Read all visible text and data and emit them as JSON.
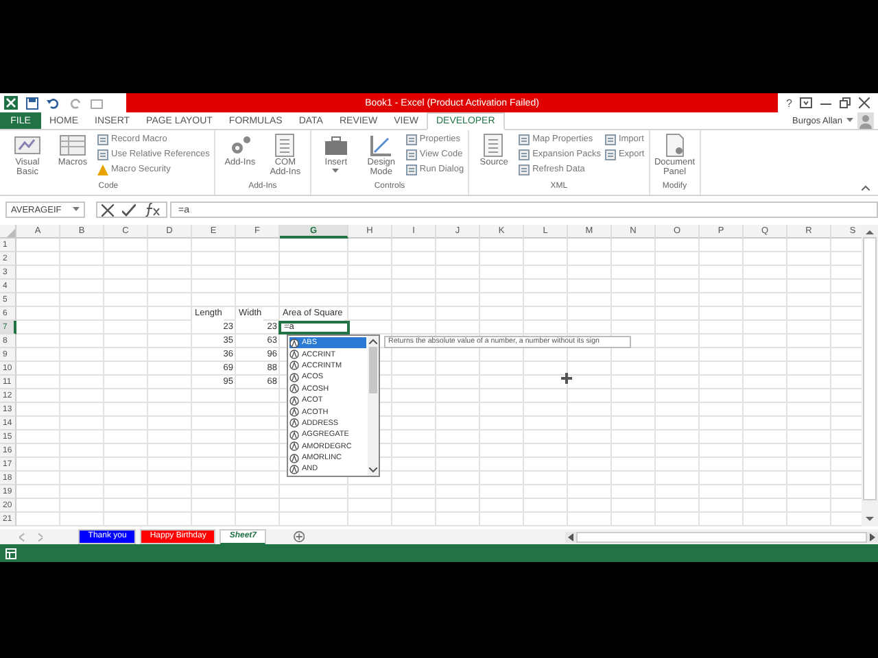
{
  "title_bar": {
    "title": "Book1 - Excel (Product Activation Failed)",
    "help": "?"
  },
  "ribbon_tabs": [
    {
      "label": "FILE",
      "kind": "file",
      "selected": false
    },
    {
      "label": "HOME",
      "kind": "tab",
      "selected": false
    },
    {
      "label": "INSERT",
      "kind": "tab",
      "selected": false
    },
    {
      "label": "PAGE LAYOUT",
      "kind": "tab",
      "selected": false
    },
    {
      "label": "FORMULAS",
      "kind": "tab",
      "selected": false
    },
    {
      "label": "DATA",
      "kind": "tab",
      "selected": false
    },
    {
      "label": "REVIEW",
      "kind": "tab",
      "selected": false
    },
    {
      "label": "VIEW",
      "kind": "tab",
      "selected": false
    },
    {
      "label": "DEVELOPER",
      "kind": "tab",
      "selected": true
    }
  ],
  "user": {
    "name": "Burgos Allan"
  },
  "ribbon_groups": [
    {
      "label": "Code",
      "large": [
        {
          "label": "Visual Basic"
        },
        {
          "label": "Macros"
        }
      ],
      "small_columns": [
        [
          {
            "label": "Record Macro"
          },
          {
            "label": "Use Relative References"
          },
          {
            "label": "Macro Security"
          }
        ]
      ]
    },
    {
      "label": "Add-Ins",
      "large": [
        {
          "label": "Add-Ins"
        },
        {
          "label": "COM Add-Ins"
        }
      ]
    },
    {
      "label": "Controls",
      "large": [
        {
          "label": "Insert",
          "has_menu": true
        },
        {
          "label": "Design Mode"
        }
      ],
      "small_columns": [
        [
          {
            "label": "Properties"
          },
          {
            "label": "View Code"
          },
          {
            "label": "Run Dialog"
          }
        ]
      ]
    },
    {
      "label": "XML",
      "large": [
        {
          "label": "Source"
        }
      ],
      "small_columns": [
        [
          {
            "label": "Map Properties"
          },
          {
            "label": "Expansion Packs"
          },
          {
            "label": "Refresh Data"
          }
        ],
        [
          {
            "label": "Import"
          },
          {
            "label": "Export"
          }
        ]
      ]
    },
    {
      "label": "Modify",
      "large": [
        {
          "label": "Document Panel"
        }
      ]
    }
  ],
  "formula_bar": {
    "name_box": "AVERAGEIF",
    "formula": "=a"
  },
  "columns": [
    {
      "label": "A",
      "selected": false
    },
    {
      "label": "B",
      "selected": false
    },
    {
      "label": "C",
      "selected": false
    },
    {
      "label": "D",
      "selected": false
    },
    {
      "label": "E",
      "selected": false
    },
    {
      "label": "F",
      "selected": false
    },
    {
      "label": "G",
      "selected": true
    },
    {
      "label": "H",
      "selected": false
    },
    {
      "label": "I",
      "selected": false
    },
    {
      "label": "J",
      "selected": false
    },
    {
      "label": "K",
      "selected": false
    },
    {
      "label": "L",
      "selected": false
    },
    {
      "label": "M",
      "selected": false
    },
    {
      "label": "N",
      "selected": false
    },
    {
      "label": "O",
      "selected": false
    },
    {
      "label": "P",
      "selected": false
    },
    {
      "label": "Q",
      "selected": false
    },
    {
      "label": "R",
      "selected": false
    },
    {
      "label": "S",
      "selected": false
    }
  ],
  "rows": [
    {
      "label": "1",
      "selected": false
    },
    {
      "label": "2",
      "selected": false
    },
    {
      "label": "3",
      "selected": false
    },
    {
      "label": "4",
      "selected": false
    },
    {
      "label": "5",
      "selected": false
    },
    {
      "label": "6",
      "selected": false
    },
    {
      "label": "7",
      "selected": true
    },
    {
      "label": "8",
      "selected": false
    },
    {
      "label": "9",
      "selected": false
    },
    {
      "label": "10",
      "selected": false
    },
    {
      "label": "11",
      "selected": false
    },
    {
      "label": "12",
      "selected": false
    },
    {
      "label": "13",
      "selected": false
    },
    {
      "label": "14",
      "selected": false
    },
    {
      "label": "15",
      "selected": false
    },
    {
      "label": "16",
      "selected": false
    },
    {
      "label": "17",
      "selected": false
    },
    {
      "label": "18",
      "selected": false
    },
    {
      "label": "19",
      "selected": false
    },
    {
      "label": "20",
      "selected": false
    },
    {
      "label": "21",
      "selected": false
    }
  ],
  "table": {
    "header": [
      "Length",
      "Width",
      "Area of Square"
    ],
    "rows": [
      [
        {
          "value": "23",
          "kind": "number"
        },
        {
          "value": "23",
          "kind": "number"
        },
        {
          "value": "=a",
          "kind": "editing"
        }
      ],
      [
        {
          "value": "35",
          "kind": "number"
        },
        {
          "value": "63",
          "kind": "number"
        }
      ],
      [
        {
          "value": "36",
          "kind": "number"
        },
        {
          "value": "96",
          "kind": "number"
        }
      ],
      [
        {
          "value": "69",
          "kind": "number"
        },
        {
          "value": "88",
          "kind": "number"
        }
      ],
      [
        {
          "value": "95",
          "kind": "number"
        },
        {
          "value": "68",
          "kind": "number"
        }
      ]
    ]
  },
  "autocomplete": {
    "items": [
      {
        "label": "ABS",
        "selected": true
      },
      {
        "label": "ACCRINT",
        "selected": false
      },
      {
        "label": "ACCRINTM",
        "selected": false
      },
      {
        "label": "ACOS",
        "selected": false
      },
      {
        "label": "ACOSH",
        "selected": false
      },
      {
        "label": "ACOT",
        "selected": false
      },
      {
        "label": "ACOTH",
        "selected": false
      },
      {
        "label": "ADDRESS",
        "selected": false
      },
      {
        "label": "AGGREGATE",
        "selected": false
      },
      {
        "label": "AMORDEGRC",
        "selected": false
      },
      {
        "label": "AMORLINC",
        "selected": false
      },
      {
        "label": "AND",
        "selected": false
      }
    ],
    "tooltip": "Returns the absolute value of a number, a number without its sign"
  },
  "sheet_tabs": [
    {
      "label": "Thank you",
      "color": "#0000ff",
      "selected": false
    },
    {
      "label": "Happy Birthday",
      "color": "#ff0000",
      "selected": false
    },
    {
      "label": "Sheet7",
      "color": "#ffffff",
      "selected": true
    }
  ]
}
